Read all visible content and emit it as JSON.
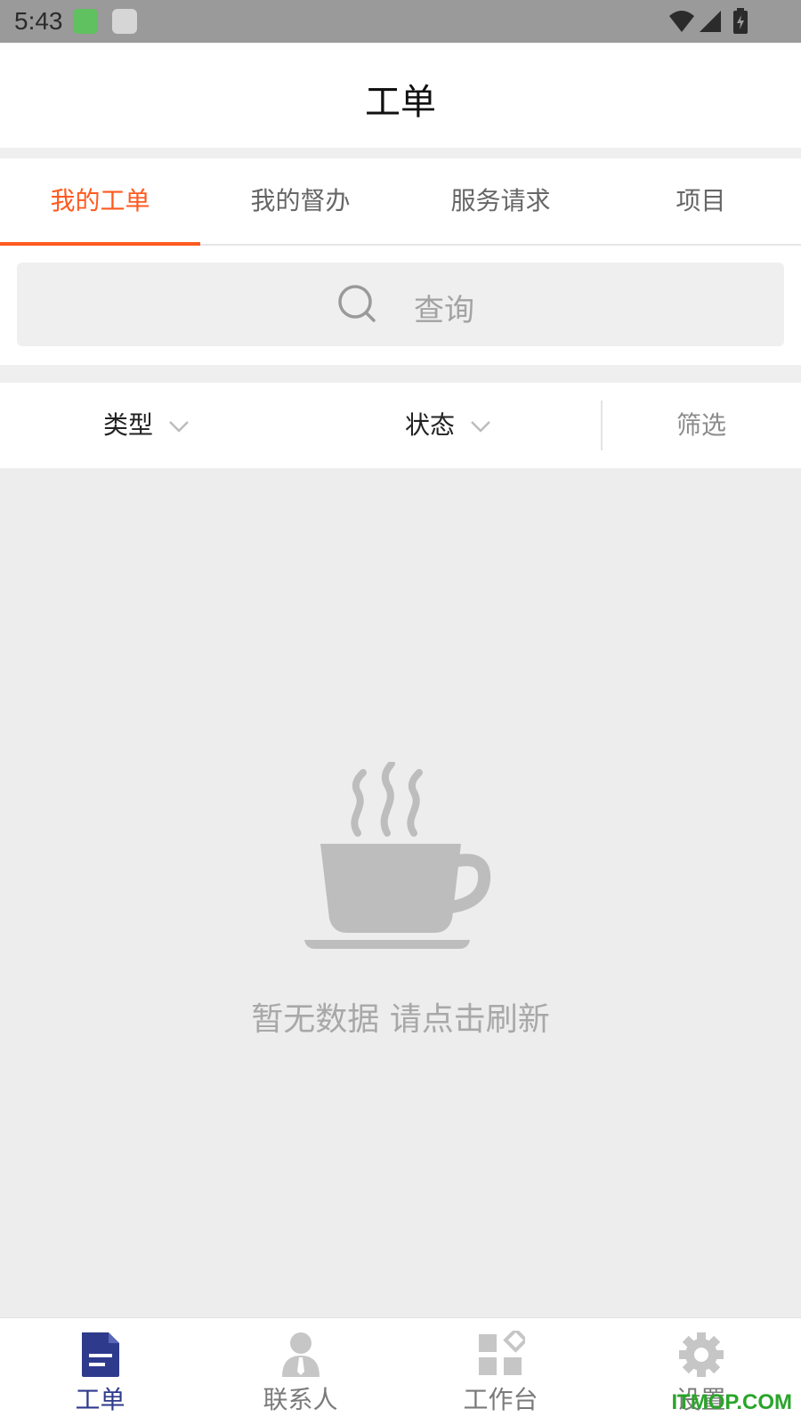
{
  "status_bar": {
    "time": "5:43"
  },
  "header": {
    "title": "工单"
  },
  "tabs": [
    {
      "label": "我的工单",
      "active": true
    },
    {
      "label": "我的督办",
      "active": false
    },
    {
      "label": "服务请求",
      "active": false
    },
    {
      "label": "项目",
      "active": false
    }
  ],
  "search": {
    "placeholder": "查询"
  },
  "filters": {
    "type_label": "类型",
    "status_label": "状态",
    "filter_label": "筛选"
  },
  "empty_state": {
    "message": "暂无数据 请点击刷新",
    "icon": "coffee-cup-icon"
  },
  "bottom_nav": [
    {
      "label": "工单",
      "icon": "document-icon",
      "active": true
    },
    {
      "label": "联系人",
      "icon": "person-icon",
      "active": false
    },
    {
      "label": "工作台",
      "icon": "apps-grid-icon",
      "active": false
    },
    {
      "label": "设置",
      "icon": "gear-icon",
      "active": false
    }
  ],
  "watermark": "ITMOP.COM",
  "colors": {
    "accent": "#ff5a1f",
    "nav_active": "#2e3a8c",
    "background": "#ededed"
  }
}
